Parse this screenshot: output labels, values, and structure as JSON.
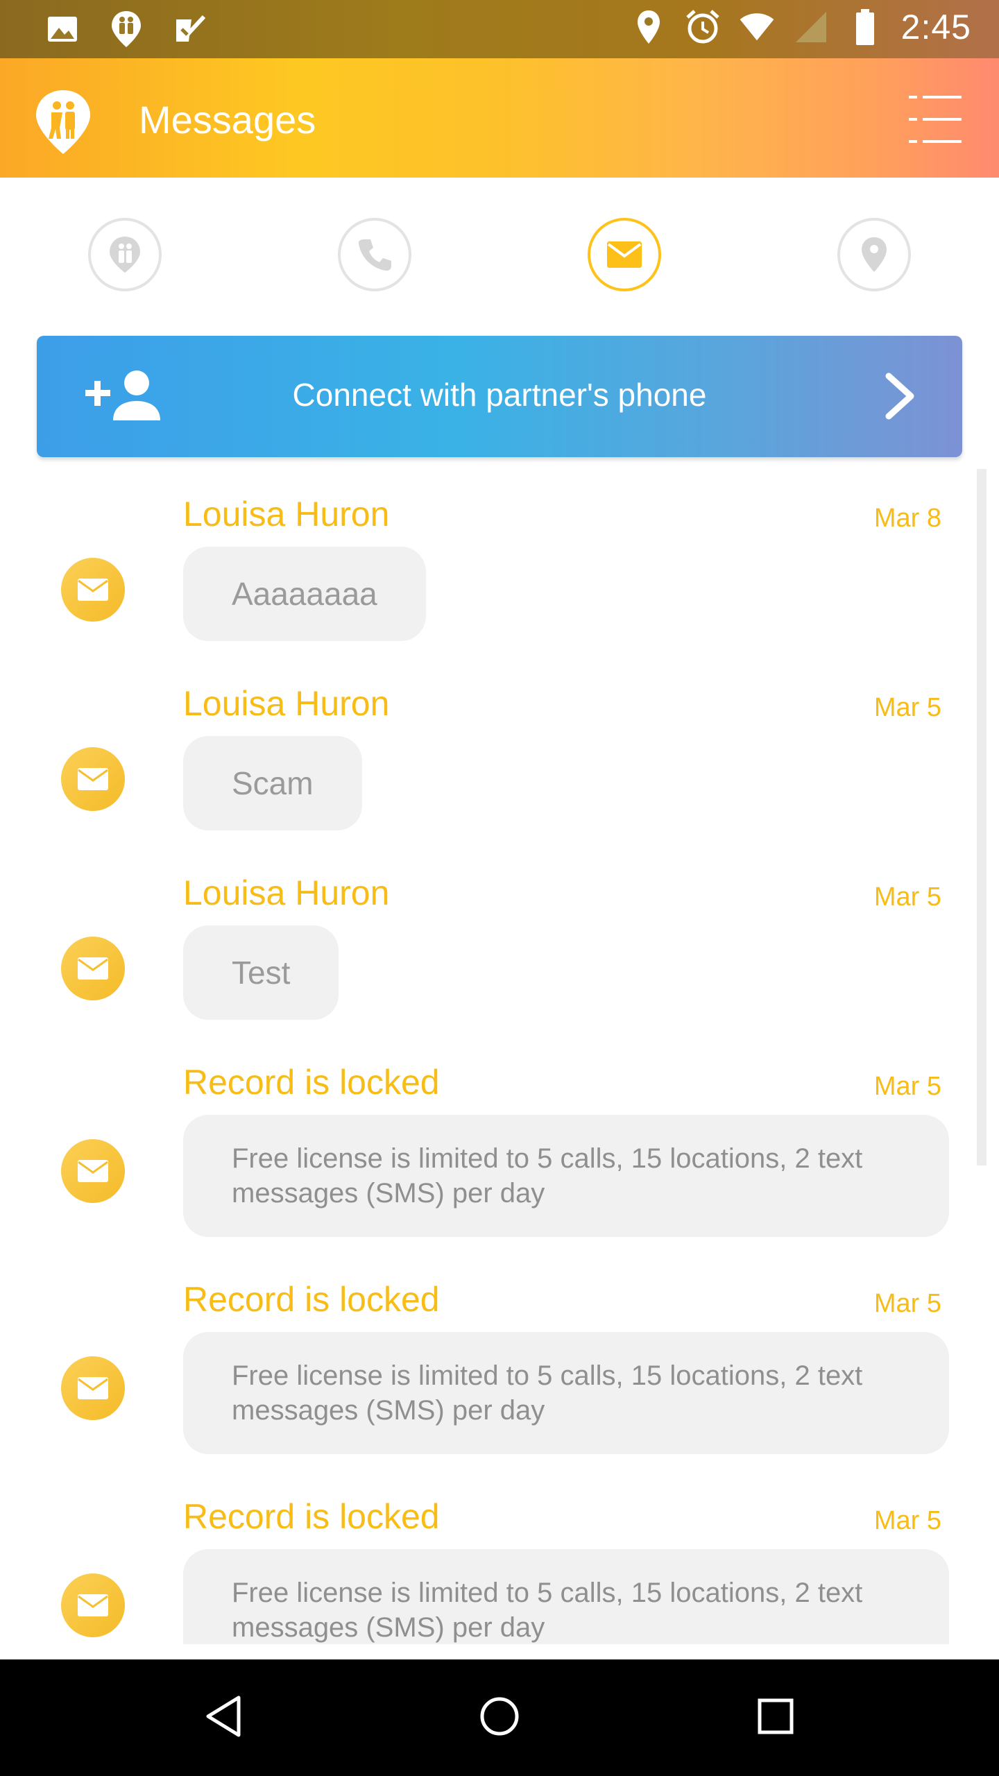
{
  "status_bar": {
    "time": "2:45",
    "left_icons": [
      "image-icon",
      "couple-pin-icon",
      "check-icon"
    ],
    "right_icons": [
      "location-icon",
      "alarm-icon",
      "wifi-icon",
      "signal-icon",
      "battery-icon"
    ]
  },
  "app_bar": {
    "title": "Messages",
    "logo_icon": "couple-pin-icon",
    "menu_icon": "list-menu-icon"
  },
  "tabs": [
    {
      "icon": "couple-pin-icon",
      "active": false
    },
    {
      "icon": "phone-icon",
      "active": false
    },
    {
      "icon": "mail-icon",
      "active": true
    },
    {
      "icon": "location-icon",
      "active": false
    }
  ],
  "connect_banner": {
    "label": "Connect with partner's phone",
    "icon": "add-user-icon",
    "chevron": "chevron-right-icon"
  },
  "messages": [
    {
      "name": "Louisa Huron",
      "date": "Mar 8",
      "text": "Aaaaaaaa",
      "wide": false
    },
    {
      "name": "Louisa Huron",
      "date": "Mar 5",
      "text": "Scam",
      "wide": false
    },
    {
      "name": "Louisa Huron",
      "date": "Mar 5",
      "text": "Test",
      "wide": false
    },
    {
      "name": "Record is locked",
      "date": "Mar 5",
      "text": "Free license is limited to 5 calls, 15 locations, 2 text messages (SMS) per day",
      "wide": true
    },
    {
      "name": "Record is locked",
      "date": "Mar 5",
      "text": "Free license is limited to 5 calls, 15 locations, 2 text messages (SMS) per day",
      "wide": true
    },
    {
      "name": "Record is locked",
      "date": "Mar 5",
      "text": "Free license is limited to 5 calls, 15 locations, 2 text messages (SMS) per day",
      "wide": true
    }
  ],
  "nav_bar": {
    "back": "back-icon",
    "home": "home-icon",
    "recents": "recents-icon"
  },
  "colors": {
    "accent": "#f8bc16",
    "banner_start": "#3d9ee8",
    "banner_end": "#7d92d4",
    "bubble": "#f1f1f1"
  }
}
